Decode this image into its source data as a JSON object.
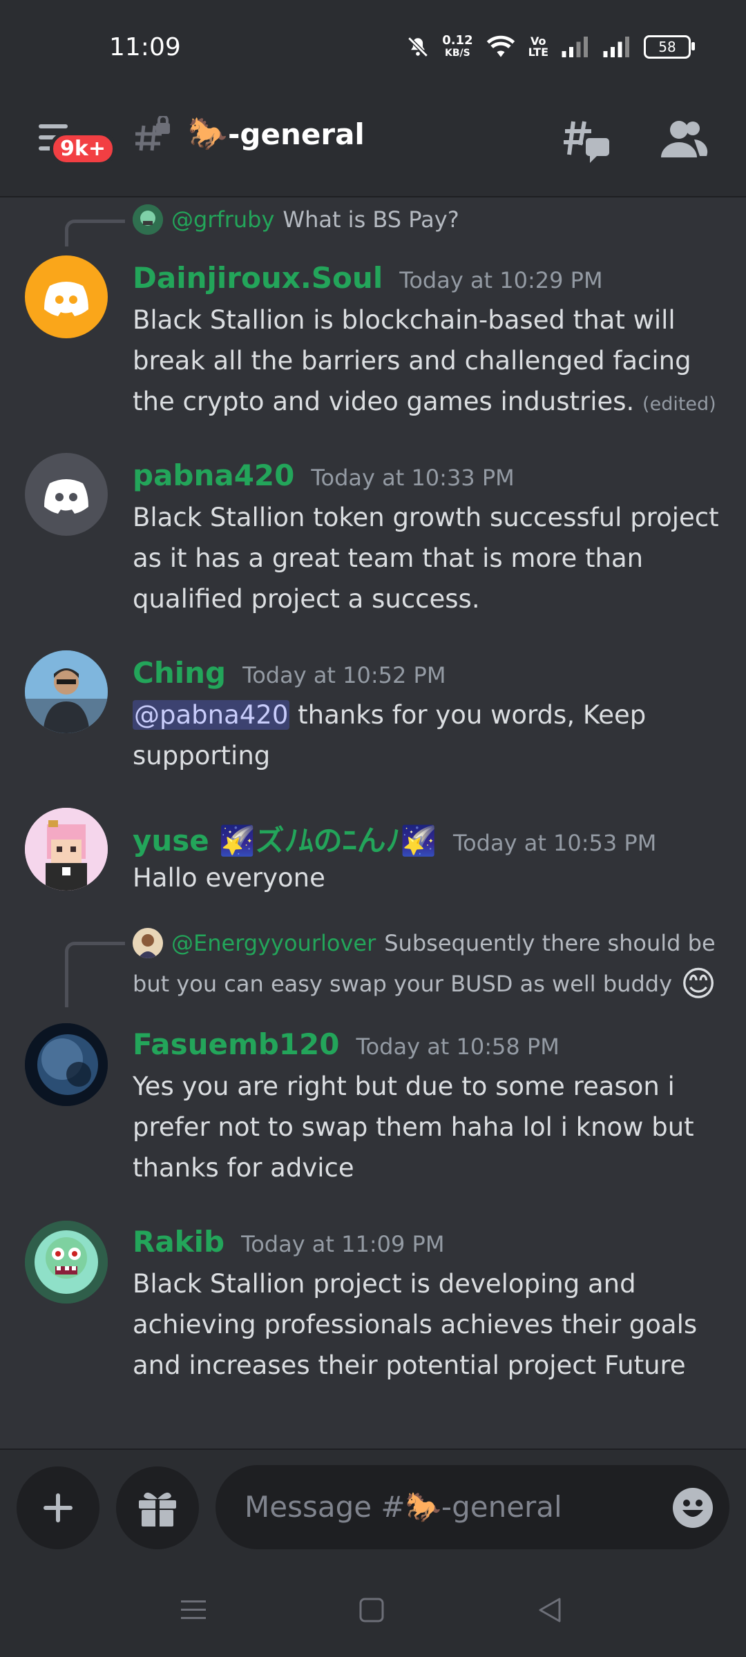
{
  "status_bar": {
    "time": "11:09",
    "net_speed_value": "0.12",
    "net_speed_unit": "KB/S",
    "volte_top": "Vo",
    "volte_bottom": "LTE",
    "battery": "58"
  },
  "header": {
    "unread_badge": "9k+",
    "channel_emoji": "🐎",
    "channel_name": "-general",
    "icons": [
      "hamburger-icon",
      "locked-channel-icon",
      "threads-icon",
      "members-icon"
    ]
  },
  "messages": [
    {
      "reply": {
        "user": "@grfruby",
        "text": "What is BS Pay?"
      },
      "username": "Dainjiroux.Soul",
      "timestamp": "Today at 10:29 PM",
      "body": "Black Stallion is blockchain-based that will break all the barriers and challenged facing the crypto and video games industries.",
      "edited": "(edited)"
    },
    {
      "username": "pabna420",
      "timestamp": "Today at 10:33 PM",
      "body": "Black Stallion token growth  successful project as it has a great team that is more than qualified  project a success."
    },
    {
      "username": "Ching",
      "timestamp": "Today at 10:52 PM",
      "mention": "@pabna420",
      "body": " thanks for you words, Keep supporting"
    },
    {
      "username": "yuse 🌠ズﾉﾑのﾆんﾉ🌠",
      "timestamp": "Today at 10:53 PM",
      "body": "Hallo everyone"
    },
    {
      "reply": {
        "user": "@Energyyourlover",
        "text": "Subsequently there should be",
        "text2": "but you can easy swap your BUSD as well buddy",
        "emoji": "😊"
      },
      "username": "Fasuemb120",
      "timestamp": "Today at 10:58 PM",
      "body": "Yes you are right but due to some reason i prefer not to swap them haha lol i know but thanks for advice"
    },
    {
      "username": "Rakib",
      "timestamp": "Today at 11:09 PM",
      "body": "Black Stallion project is developing and achieving  professionals achieves their goals and increases their potential project Future"
    }
  ],
  "composer": {
    "placeholder": "Message #🐎-general"
  },
  "colors": {
    "background": "#313338",
    "username": "#23a55a",
    "badge": "#f23f43",
    "discord_orange": "#faa61a",
    "discord_grey": "#4e5058"
  }
}
